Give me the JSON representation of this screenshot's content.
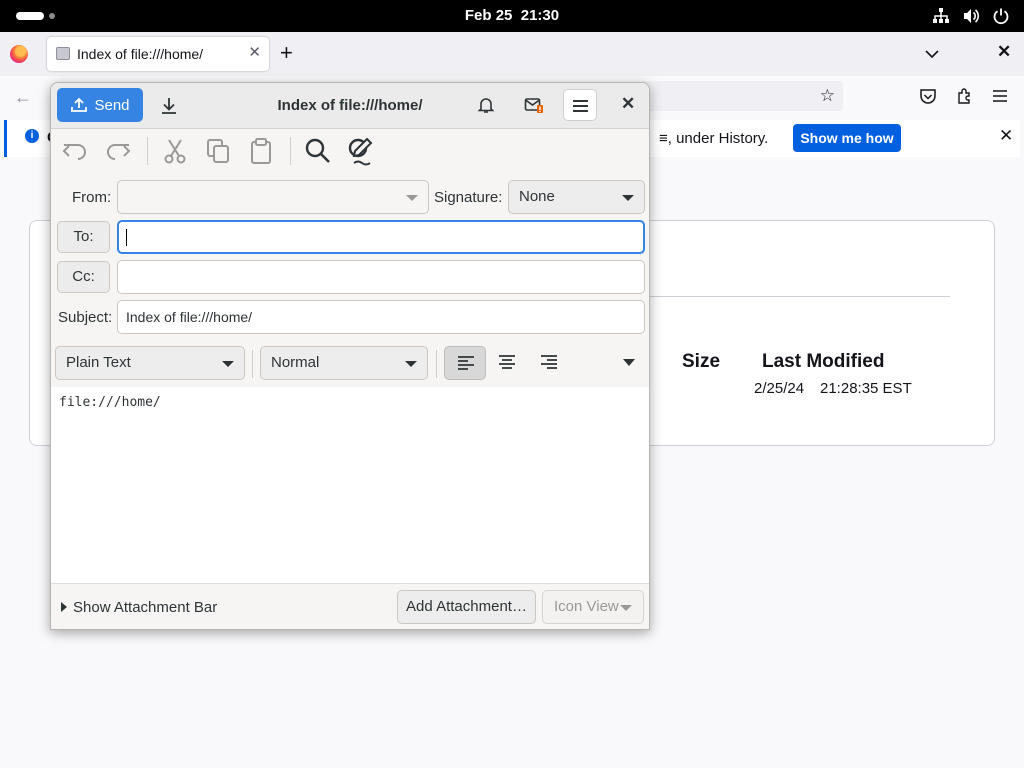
{
  "system_bar": {
    "date": "Feb 25",
    "time": "21:30",
    "tray_icons": [
      "network-icon",
      "volume-icon",
      "power-icon"
    ]
  },
  "browser": {
    "tab_title": "Index of file:///home/",
    "notification": {
      "leading_text": "C",
      "text": "≡, under History.",
      "button_label": "Show me how"
    },
    "directory_listing": {
      "columns": [
        "Size",
        "Last Modified"
      ],
      "rows": [
        {
          "size": "",
          "date": "2/25/24",
          "time": "21:28:35 EST"
        }
      ]
    }
  },
  "compose": {
    "title": "Index of file:///home/",
    "send_label": "Send",
    "from_label": "From:",
    "from_value": "",
    "signature_label": "Signature:",
    "signature_value": "None",
    "to_label": "To:",
    "to_value": "",
    "cc_label": "Cc:",
    "cc_value": "",
    "subject_label": "Subject:",
    "subject_value": "Index of file:///home/",
    "format_mode": "Plain Text",
    "paragraph_style": "Normal",
    "body_text": "file:///home/",
    "attachment_toggle": "Show Attachment Bar",
    "add_attachment": "Add Attachment…",
    "view_mode": "Icon View",
    "accent_color": "#3584e4"
  }
}
